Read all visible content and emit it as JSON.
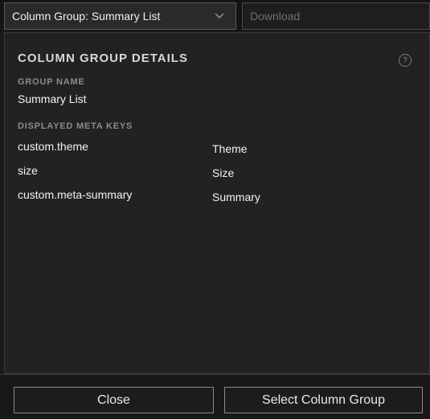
{
  "toolbar": {
    "column_group_select": "Column Group: Summary List",
    "download_placeholder": "Download"
  },
  "details": {
    "title": "COLUMN GROUP DETAILS",
    "help_icon": "question-circle-icon",
    "group_name_label": "GROUP NAME",
    "group_name_value": "Summary List",
    "meta_keys_label": "DISPLAYED META KEYS",
    "meta_keys": [
      {
        "key": "custom.theme",
        "display": "Theme"
      },
      {
        "key": "size",
        "display": "Size"
      },
      {
        "key": "custom.meta-summary",
        "display": "Summary"
      }
    ]
  },
  "footer": {
    "close_label": "Close",
    "select_label": "Select Column Group"
  }
}
